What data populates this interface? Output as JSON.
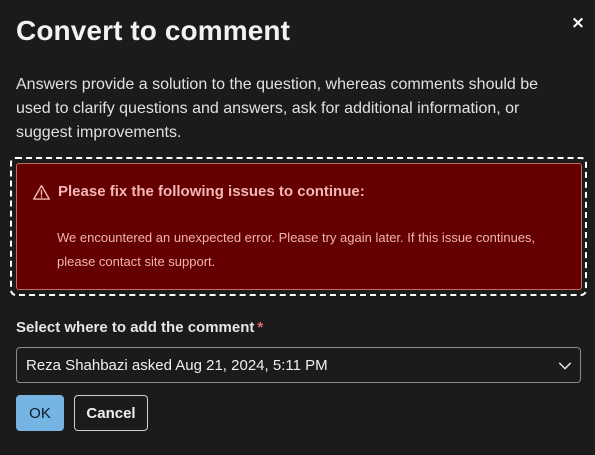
{
  "dialog": {
    "title": "Convert to comment",
    "close_glyph": "×",
    "description": "Answers provide a solution to the question, whereas comments should be used to clarify questions and answers, ask for additional information, or suggest improvements."
  },
  "error": {
    "icon": "warning-triangle-icon",
    "title": "Please fix the following issues to continue:",
    "message": "We encountered an unexpected error. Please try again later. If this issue continues, please contact site support.",
    "background_color": "#640000",
    "text_color": "#f4b6b6"
  },
  "field": {
    "label": "Select where to add the comment",
    "required_marker": "*",
    "selected_value": "Reza Shahbazi asked Aug 21, 2024, 5:11 PM",
    "icon": "chevron-down-icon"
  },
  "buttons": {
    "ok_label": "OK",
    "cancel_label": "Cancel",
    "primary_color": "#76b4e4"
  }
}
